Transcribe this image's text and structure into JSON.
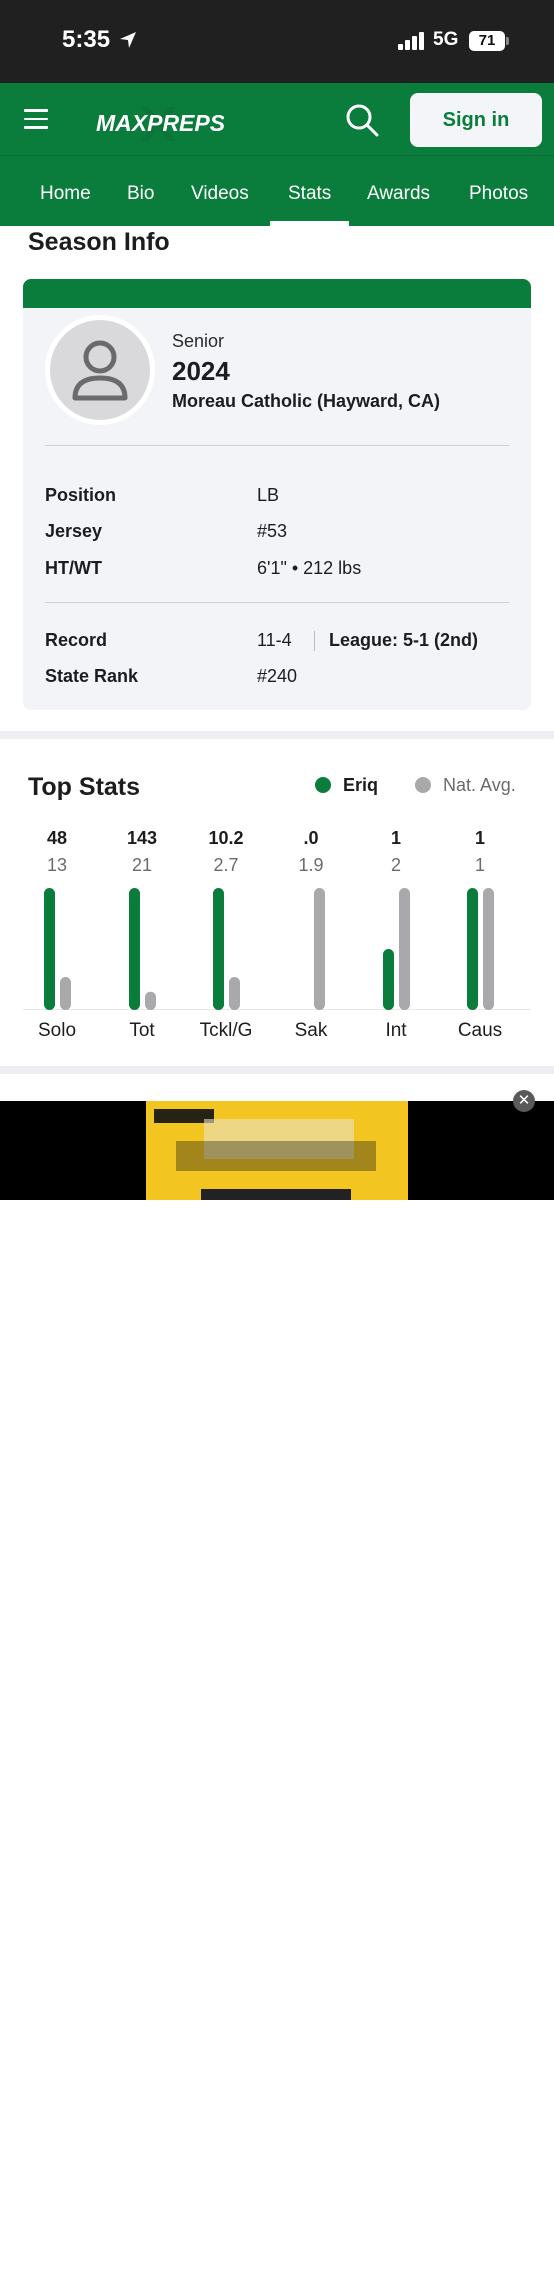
{
  "status_bar": {
    "time": "5:35",
    "network": "5G",
    "battery": "71"
  },
  "header": {
    "logo_text": "MAXPREPS",
    "sign_in_label": "Sign in"
  },
  "nav": {
    "tabs": [
      "Home",
      "Bio",
      "Videos",
      "Stats",
      "Awards",
      "Photos"
    ],
    "active": "Stats"
  },
  "season_info": {
    "title": "Season Info",
    "class_year": "Senior",
    "grad_year": "2024",
    "school": "Moreau Catholic (Hayward, CA)",
    "position_label": "Position",
    "position": "LB",
    "jersey_label": "Jersey",
    "jersey": "#53",
    "htwt_label": "HT/WT",
    "htwt": "6'1\" • 212 lbs",
    "record_label": "Record",
    "record": "11-4",
    "league": "League: 5-1 (2nd)",
    "state_rank_label": "State Rank",
    "state_rank": "#240"
  },
  "top_stats": {
    "title": "Top Stats",
    "legend_player": "Eriq",
    "legend_nat": "Nat. Avg.",
    "colors": {
      "player": "#0a7d3c",
      "nat": "#a9a9ac"
    }
  },
  "chart_data": {
    "type": "bar",
    "categories": [
      "Solo",
      "Tot",
      "Tckl/G",
      "Sak",
      "Int",
      "Caus"
    ],
    "player_labels": [
      "48",
      "143",
      "10.2",
      ".0",
      "1",
      "1"
    ],
    "nat_labels": [
      "13",
      "21",
      "2.7",
      "1.9",
      "2",
      "1"
    ],
    "series": [
      {
        "name": "Eriq",
        "values": [
          48,
          143,
          10.2,
          0,
          1,
          1
        ],
        "relative_height": [
          1.0,
          1.0,
          1.0,
          0.0,
          0.5,
          1.0
        ]
      },
      {
        "name": "Nat. Avg.",
        "values": [
          13,
          21,
          2.7,
          1.9,
          2,
          1
        ],
        "relative_height": [
          0.27,
          0.15,
          0.27,
          1.0,
          1.0,
          1.0
        ]
      }
    ]
  }
}
